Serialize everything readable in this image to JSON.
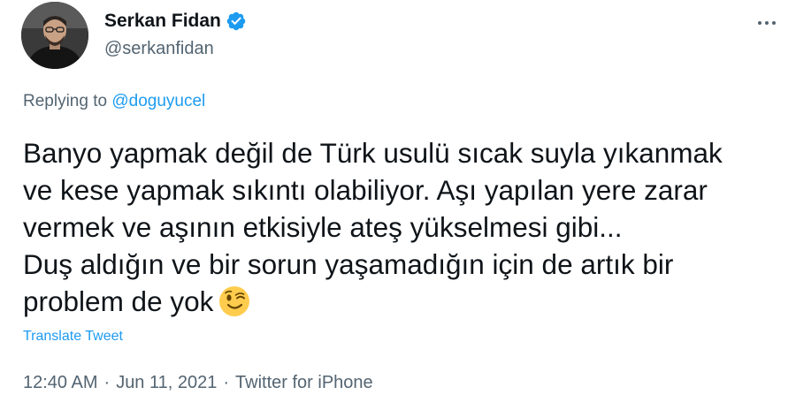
{
  "author": {
    "display_name": "Serkan Fidan",
    "handle": "@serkanfidan",
    "verified": true
  },
  "reply": {
    "prefix": "Replying to",
    "to_handle": "@doguyucel"
  },
  "tweet": {
    "lines": [
      "Banyo yapmak değil de Türk usulü sıcak suyla yıkanmak",
      "ve kese yapmak sıkıntı olabiliyor. Aşı yapılan yere zarar",
      "vermek ve aşının etkisiyle ateş yükselmesi gibi...",
      "Duş aldığın ve bir sorun yaşamadığın için de artık bir",
      "problem de yok"
    ],
    "emoji": "winking-face"
  },
  "translate_label": "Translate Tweet",
  "meta": {
    "time": "12:40 AM",
    "separator": "·",
    "date": "Jun 11, 2021",
    "source": "Twitter for iPhone"
  },
  "colors": {
    "link": "#1d9bf0",
    "secondary_text": "#536471",
    "primary_text": "#0f1419",
    "verified": "#1d9bf0"
  }
}
